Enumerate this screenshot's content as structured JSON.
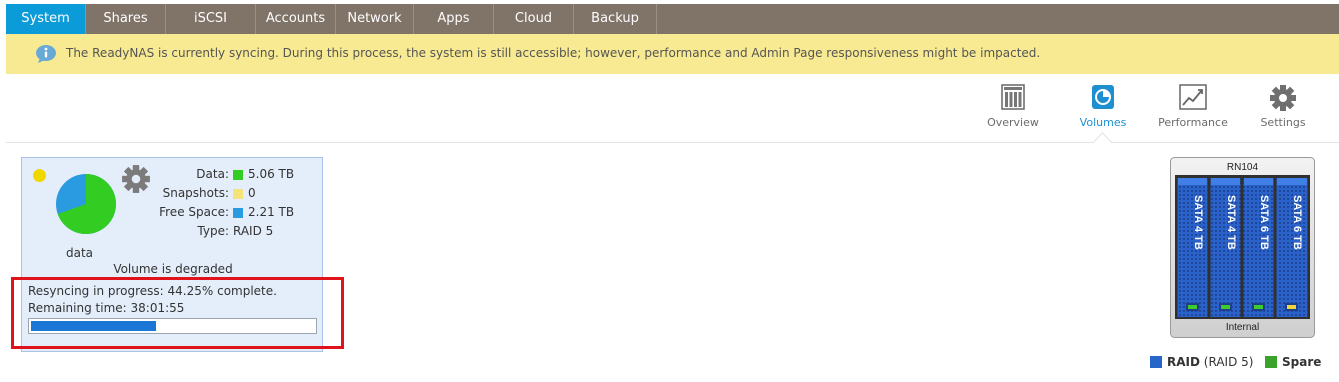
{
  "nav": {
    "tabs": [
      {
        "label": "System",
        "active": true
      },
      {
        "label": "Shares",
        "active": false
      },
      {
        "label": "iSCSI",
        "active": false
      },
      {
        "label": "Accounts",
        "active": false
      },
      {
        "label": "Network",
        "active": false
      },
      {
        "label": "Apps",
        "active": false
      },
      {
        "label": "Cloud",
        "active": false
      },
      {
        "label": "Backup",
        "active": false
      }
    ]
  },
  "banner": {
    "icon": "chat-bubble-info-icon",
    "text": "The ReadyNAS is currently syncing. During this process, the system is still accessible; however, performance and Admin Page responsiveness might be impacted."
  },
  "subnav": {
    "items": [
      {
        "label": "Overview",
        "icon": "overview-icon",
        "active": false
      },
      {
        "label": "Volumes",
        "icon": "volumes-icon",
        "active": true
      },
      {
        "label": "Performance",
        "icon": "performance-icon",
        "active": false
      },
      {
        "label": "Settings",
        "icon": "settings-icon",
        "active": false
      }
    ]
  },
  "volume": {
    "name": "data",
    "status_color": "#f1d700",
    "stats": {
      "data_label": "Data:",
      "data_value": "5.06 TB",
      "data_color": "#33cc22",
      "snapshots_label": "Snapshots:",
      "snapshots_value": "0",
      "snapshots_color": "#f6e27a",
      "free_label": "Free Space:",
      "free_value": "2.21 TB",
      "free_color": "#2a9be0",
      "type_label": "Type:",
      "type_value": "RAID 5"
    },
    "usage_fraction_data": 0.696,
    "degraded_text": "Volume is degraded",
    "resync_text": "Resyncing in progress: 44.25% complete.",
    "remaining_text": "Remaining time: 38:01:55",
    "progress_percent": 44.25
  },
  "device": {
    "model": "RN104",
    "disks": [
      "SATA 4 TB",
      "SATA 4 TB",
      "SATA 6 TB",
      "SATA 6 TB"
    ],
    "location_label": "Internal"
  },
  "legend": {
    "raid_label": "RAID",
    "raid_detail": "(RAID 5)",
    "raid_color": "#2566c8",
    "spare_label": "Spare",
    "spare_color": "#3aa32c"
  }
}
